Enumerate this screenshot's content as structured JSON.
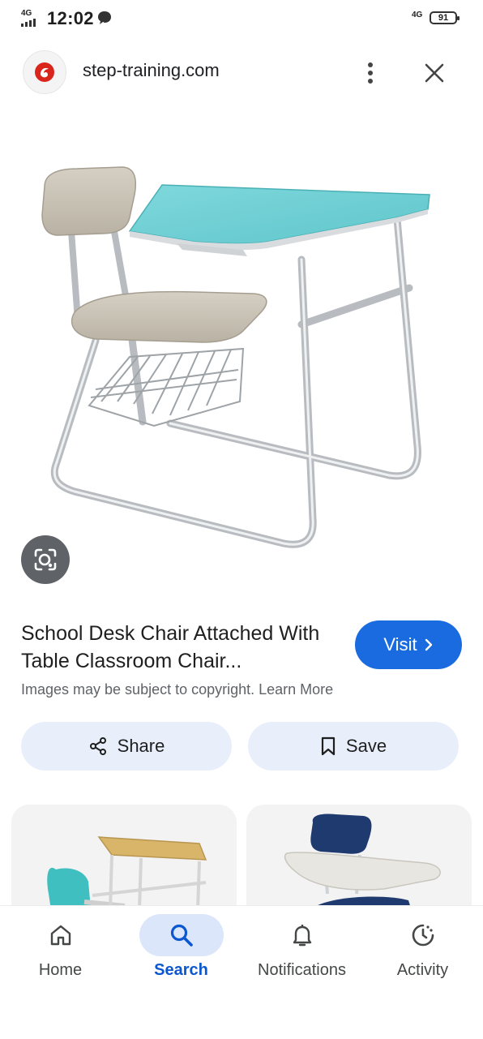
{
  "status_bar": {
    "network": "4G",
    "time": "12:02",
    "network_right": "4G",
    "battery": "91"
  },
  "header": {
    "site": "step-training.com",
    "logo_icon": "site-logo-icon",
    "menu_icon": "more-vert-icon",
    "close_icon": "close-icon"
  },
  "image": {
    "alt": "School desk chair with attached table and wire basket",
    "lens_icon": "google-lens-icon"
  },
  "result": {
    "title": "School Desk Chair Attached With Table Classroom Chair...",
    "visit_label": "Visit",
    "copyright": "Images may be subject to copyright. Learn More",
    "share_label": "Share",
    "save_label": "Save"
  },
  "bottom_nav": {
    "items": [
      {
        "label": "Home",
        "icon": "home-icon"
      },
      {
        "label": "Search",
        "icon": "search-icon",
        "active": true
      },
      {
        "label": "Notifications",
        "icon": "bell-icon"
      },
      {
        "label": "Activity",
        "icon": "activity-icon"
      }
    ]
  },
  "colors": {
    "accent": "#1a6be0",
    "pill_bg": "#e8effb",
    "nav_active_bg": "#dbe6fb",
    "nav_active_text": "#0b57d0"
  }
}
